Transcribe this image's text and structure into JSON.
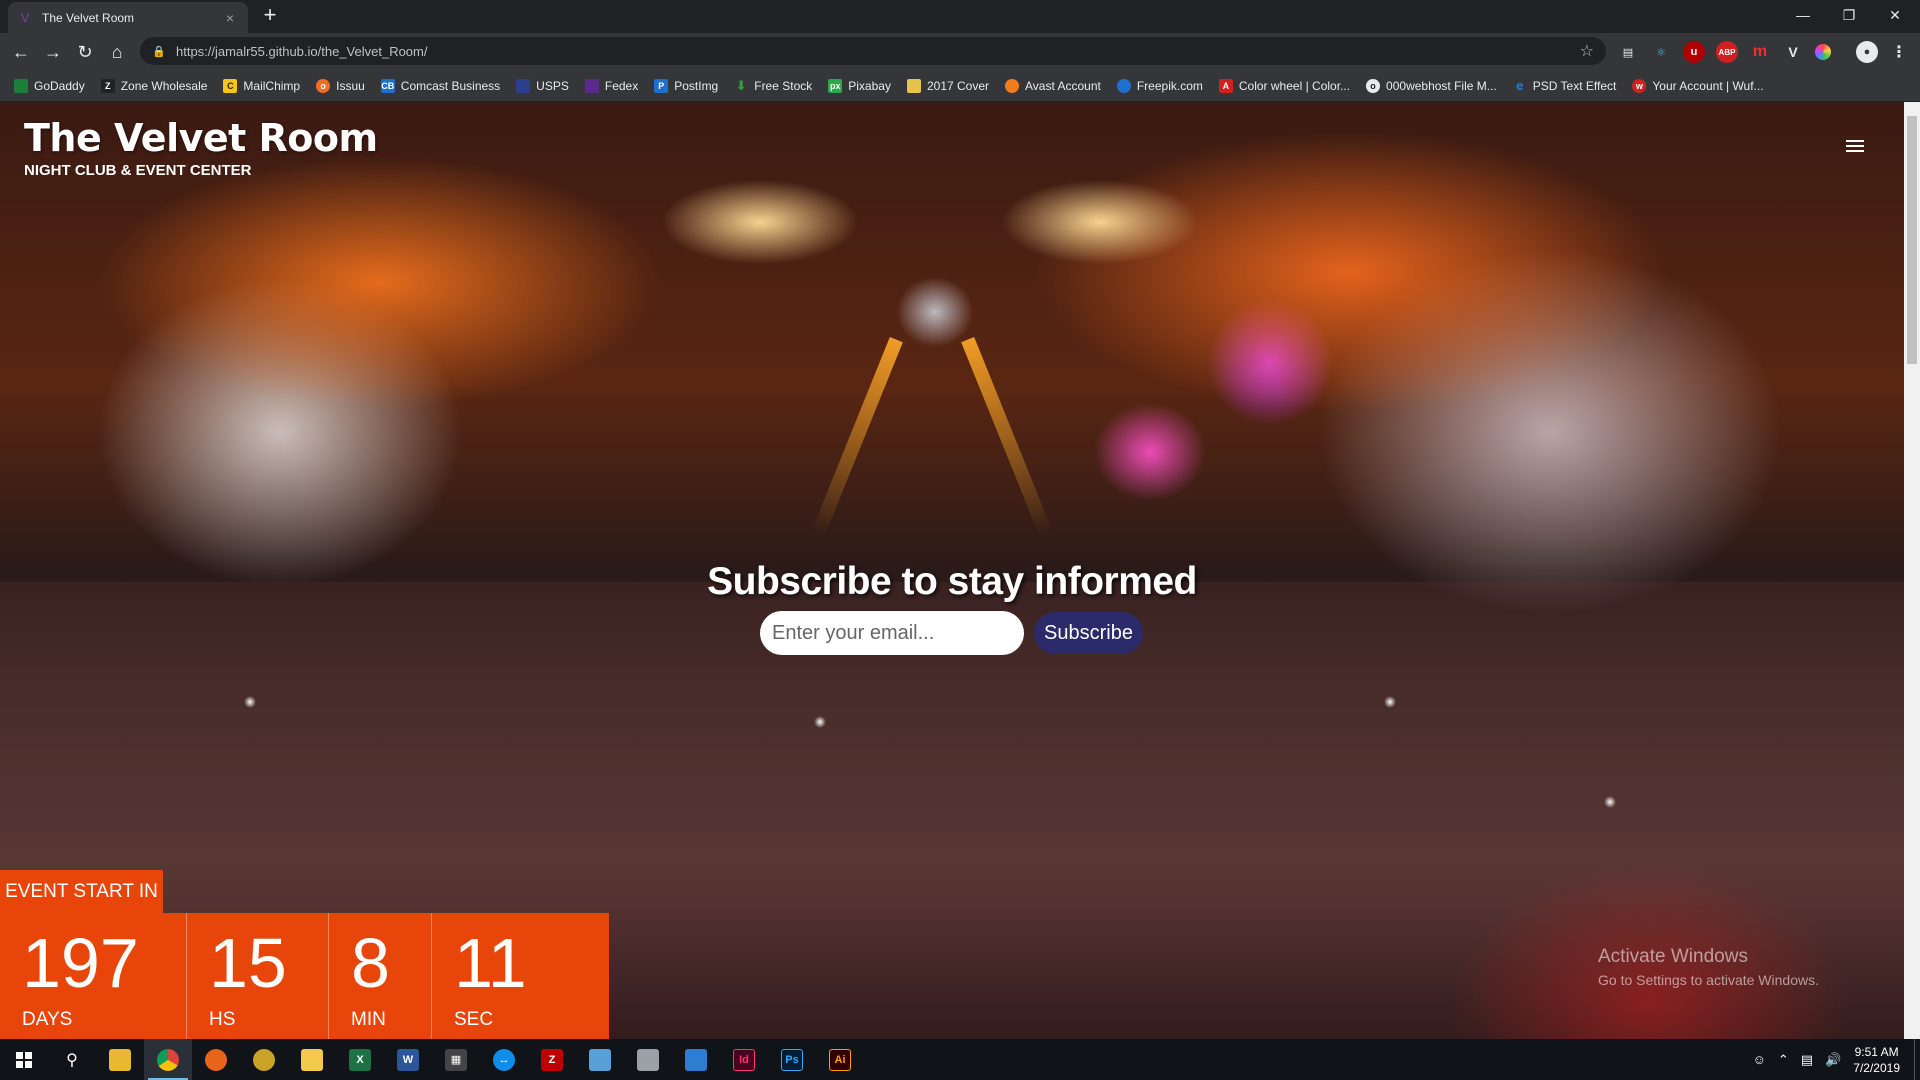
{
  "browser": {
    "tab_title": "The Velvet Room",
    "tab_close": "×",
    "new_tab": "+",
    "url": "https://jamalr55.github.io/the_Velvet_Room/",
    "bookmarks": [
      {
        "label": "GoDaddy",
        "color": "#1b7f3b"
      },
      {
        "label": "Zone Wholesale",
        "color": "#222222"
      },
      {
        "label": "MailChimp",
        "color": "#f5c518"
      },
      {
        "label": "Issuu",
        "color": "#f36d21"
      },
      {
        "label": "Comcast Business",
        "color": "#1f6fd1"
      },
      {
        "label": "USPS",
        "color": "#2b3f8c"
      },
      {
        "label": "Fedex",
        "color": "#5d2a8c"
      },
      {
        "label": "PostImg",
        "color": "#1f6fd1"
      },
      {
        "label": "Free Stock",
        "color": "#3a9a3a"
      },
      {
        "label": "Pixabay",
        "color": "#2ba84a"
      },
      {
        "label": "2017 Cover",
        "color": "#e8c34a"
      },
      {
        "label": "Avast Account",
        "color": "#f07c1b"
      },
      {
        "label": "Freepik.com",
        "color": "#1f6fd1"
      },
      {
        "label": "Color wheel | Color...",
        "color": "#d21f1f"
      },
      {
        "label": "000webhost File M...",
        "color": "#e8eaed"
      },
      {
        "label": "PSD Text Effect",
        "color": "#2b7cd3"
      },
      {
        "label": "Your Account | Wuf...",
        "color": "#d21f1f"
      }
    ]
  },
  "site": {
    "title": "The Velvet Room",
    "subtitle": "NIGHT CLUB & EVENT CENTER",
    "subscribe_heading": "Subscribe to stay informed",
    "email_placeholder": "Enter your email...",
    "subscribe_button": "Subscribe",
    "event_label": "EVENT START IN",
    "countdown": [
      {
        "value": "197",
        "unit": "DAYS"
      },
      {
        "value": "15",
        "unit": "HS"
      },
      {
        "value": "8",
        "unit": "MIN"
      },
      {
        "value": "11",
        "unit": "SEC"
      }
    ]
  },
  "watermark": {
    "line1": "Activate Windows",
    "line2": "Go to Settings to activate Windows."
  },
  "taskbar": {
    "time": "9:51 AM",
    "date": "7/2/2019"
  }
}
